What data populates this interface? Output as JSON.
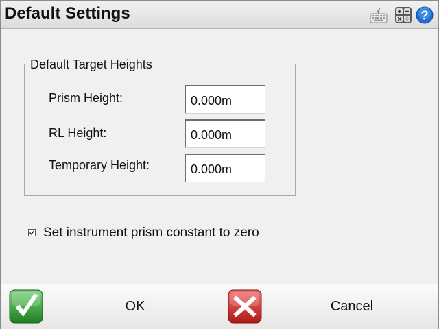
{
  "window": {
    "title": "Default Settings"
  },
  "toolbar": {
    "icons": [
      "keyboard-icon",
      "calculator-icon",
      "help-icon"
    ]
  },
  "group": {
    "legend": "Default Target Heights",
    "fields": [
      {
        "label": "Prism Height:",
        "value": "0.000m"
      },
      {
        "label": "RL Height:",
        "value": "0.000m"
      },
      {
        "label": "Temporary Height:",
        "value": "0.000m"
      }
    ]
  },
  "option": {
    "label": "Set instrument prism constant to zero",
    "checked": true
  },
  "buttons": {
    "ok_label": "OK",
    "cancel_label": "Cancel"
  },
  "colors": {
    "ok_green": "#2f9a2f",
    "cancel_red": "#d22a2a",
    "help_blue": "#1f6fd0"
  }
}
